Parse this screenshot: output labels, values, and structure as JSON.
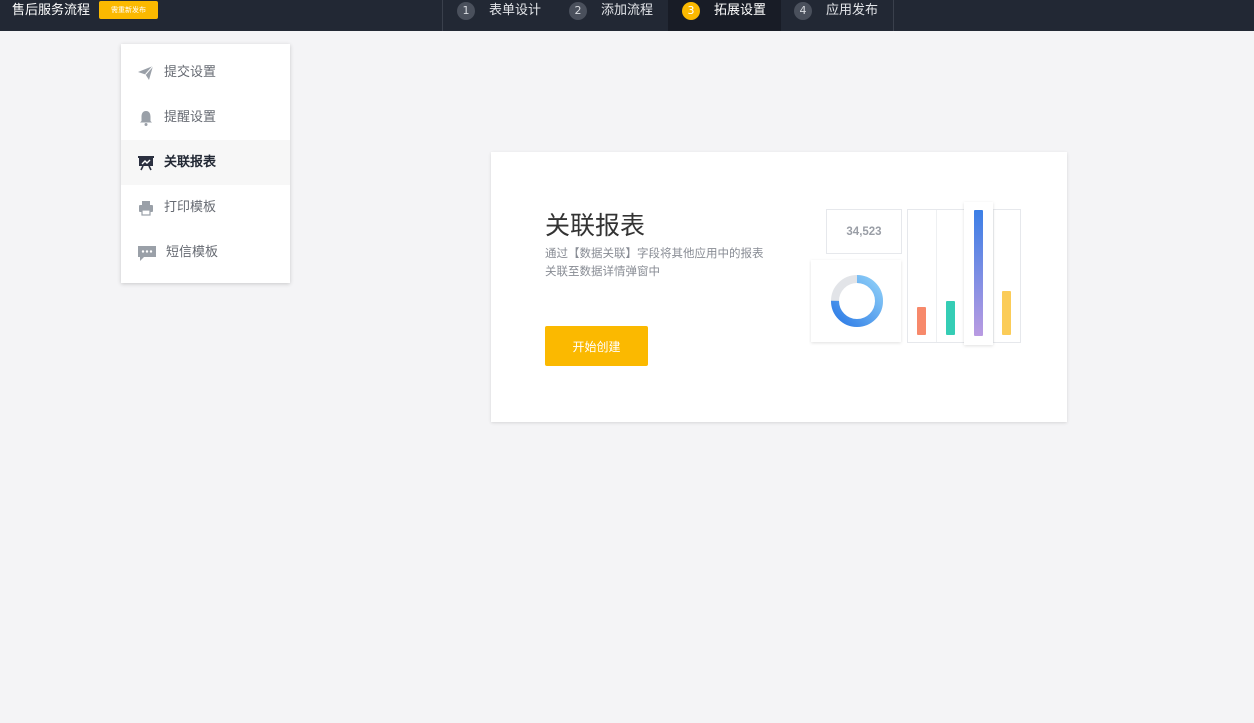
{
  "app": {
    "title": "售后服务流程",
    "badge": "需重新发布"
  },
  "steps": [
    {
      "num": "1",
      "label": "表单设计",
      "active": false
    },
    {
      "num": "2",
      "label": "添加流程",
      "active": false
    },
    {
      "num": "3",
      "label": "拓展设置",
      "active": true
    },
    {
      "num": "4",
      "label": "应用发布",
      "active": false
    }
  ],
  "sidebar": {
    "items": [
      {
        "label": "提交设置",
        "icon": "send-icon",
        "active": false
      },
      {
        "label": "提醒设置",
        "icon": "bell-icon",
        "active": false
      },
      {
        "label": "关联报表",
        "icon": "report-board-icon",
        "active": true
      },
      {
        "label": "打印模板",
        "icon": "printer-icon",
        "active": false
      },
      {
        "label": "短信模板",
        "icon": "message-icon",
        "active": false
      }
    ]
  },
  "main": {
    "title": "关联报表",
    "description": "通过【数据关联】字段将其他应用中的报表关联至数据详情弹窗中",
    "create_button": "开始创建",
    "illustration": {
      "stat_value": "34,523",
      "donut_fraction": 0.75,
      "colors": {
        "accent": "#fbb900",
        "donut": "#3c8ef0",
        "bar_red": "#f7896b",
        "bar_teal": "#35cdb5",
        "bar_blue": "#3b7fe6",
        "bar_purple": "#b99be2",
        "bar_yellow": "#fbcc58"
      }
    }
  }
}
